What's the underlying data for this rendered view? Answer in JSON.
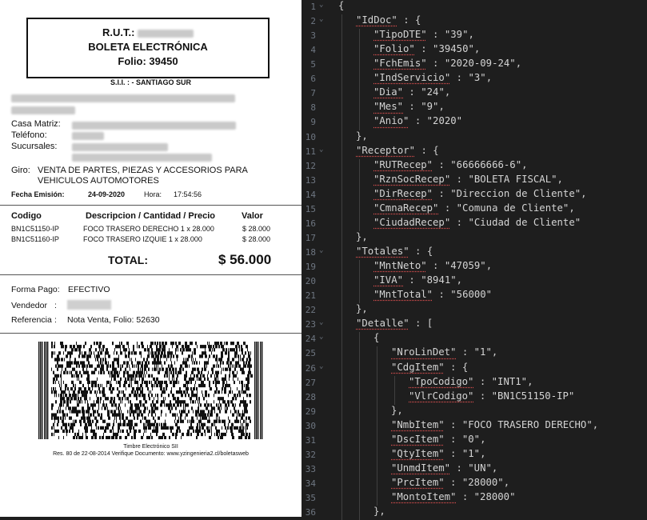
{
  "receipt": {
    "rut_label": "R.U.T.:",
    "doc_type": "BOLETA ELECTRÓNICA",
    "folio_line": "Folio: 39450",
    "sii_office": "S.I.I. : - SANTIAGO SUR",
    "casa_matriz_label": "Casa Matriz:",
    "telefono_label": "Teléfono:",
    "sucursales_label": "Sucursales:",
    "giro_label": "Giro:",
    "giro_line1": "VENTA DE PARTES, PIEZAS Y ACCESORIOS PARA",
    "giro_line2": "VEHICULOS AUTOMOTORES",
    "fecha_label": "Fecha Emisión:",
    "fecha_value": "24-09-2020",
    "hora_label": "Hora:",
    "hora_value": "17:54:56",
    "col_codigo": "Codigo",
    "col_desc": "Descripcion / Cantidad / Precio",
    "col_valor": "Valor",
    "items": [
      {
        "code": "BN1C51150-IP",
        "desc": "FOCO TRASERO DERECHO 1 x 28.000",
        "value": "$ 28.000"
      },
      {
        "code": "BN1C51160-IP",
        "desc": "FOCO TRASERO IZQUIE 1 x 28.000",
        "value": "$ 28.000"
      }
    ],
    "total_label": "TOTAL:",
    "total_value": "$ 56.000",
    "forma_pago_label": "Forma Pago:",
    "forma_pago_value": "EFECTIVO",
    "vendedor_label": "Vendedor",
    "vendedor_sep": ":",
    "referencia_label": "Referencia",
    "referencia_sep": ":",
    "referencia_value": "Nota Venta, Folio: 52630",
    "timbre_label": "Timbre Electrónico SII",
    "resolution_line": "Res. 80 de 22-08-2014 Verifique Documento: www.yzingenieria2.cl/boletasweb"
  },
  "editor": {
    "lines": [
      {
        "n": "1",
        "fold": "⌄",
        "indent": 0,
        "parts": [
          [
            "p",
            "{"
          ]
        ]
      },
      {
        "n": "2",
        "fold": "⌄",
        "indent": 1,
        "parts": [
          [
            "k",
            "\"IdDoc\""
          ],
          [
            "p",
            " : {"
          ]
        ]
      },
      {
        "n": "3",
        "fold": "",
        "indent": 2,
        "parts": [
          [
            "k",
            "\"TipoDTE\""
          ],
          [
            "p",
            " : "
          ],
          [
            "v",
            "\"39\""
          ],
          [
            "p",
            ","
          ]
        ]
      },
      {
        "n": "4",
        "fold": "",
        "indent": 2,
        "parts": [
          [
            "k",
            "\"Folio\""
          ],
          [
            "p",
            " : "
          ],
          [
            "v",
            "\"39450\""
          ],
          [
            "p",
            ","
          ]
        ]
      },
      {
        "n": "5",
        "fold": "",
        "indent": 2,
        "parts": [
          [
            "k",
            "\"FchEmis\""
          ],
          [
            "p",
            " : "
          ],
          [
            "v",
            "\"2020-09-24\""
          ],
          [
            "p",
            ","
          ]
        ]
      },
      {
        "n": "6",
        "fold": "",
        "indent": 2,
        "parts": [
          [
            "k",
            "\"IndServicio\""
          ],
          [
            "p",
            " : "
          ],
          [
            "v",
            "\"3\""
          ],
          [
            "p",
            ","
          ]
        ]
      },
      {
        "n": "7",
        "fold": "",
        "indent": 2,
        "parts": [
          [
            "k",
            "\"Dia\""
          ],
          [
            "p",
            " : "
          ],
          [
            "v",
            "\"24\""
          ],
          [
            "p",
            ","
          ]
        ]
      },
      {
        "n": "8",
        "fold": "",
        "indent": 2,
        "parts": [
          [
            "k",
            "\"Mes\""
          ],
          [
            "p",
            " : "
          ],
          [
            "v",
            "\"9\""
          ],
          [
            "p",
            ","
          ]
        ]
      },
      {
        "n": "9",
        "fold": "",
        "indent": 2,
        "parts": [
          [
            "k",
            "\"Anio\""
          ],
          [
            "p",
            " : "
          ],
          [
            "v",
            "\"2020\""
          ]
        ]
      },
      {
        "n": "10",
        "fold": "",
        "indent": 1,
        "parts": [
          [
            "p",
            "},"
          ]
        ]
      },
      {
        "n": "11",
        "fold": "⌄",
        "indent": 1,
        "parts": [
          [
            "k",
            "\"Receptor\""
          ],
          [
            "p",
            " : {"
          ]
        ]
      },
      {
        "n": "12",
        "fold": "",
        "indent": 2,
        "parts": [
          [
            "k",
            "\"RUTRecep\""
          ],
          [
            "p",
            " : "
          ],
          [
            "v",
            "\"66666666-6\""
          ],
          [
            "p",
            ","
          ]
        ]
      },
      {
        "n": "13",
        "fold": "",
        "indent": 2,
        "parts": [
          [
            "k",
            "\"RznSocRecep\""
          ],
          [
            "p",
            " : "
          ],
          [
            "v",
            "\"BOLETA FISCAL\""
          ],
          [
            "p",
            ","
          ]
        ]
      },
      {
        "n": "14",
        "fold": "",
        "indent": 2,
        "parts": [
          [
            "k",
            "\"DirRecep\""
          ],
          [
            "p",
            " : "
          ],
          [
            "v",
            "\"Direccion de Cliente\""
          ],
          [
            "p",
            ","
          ]
        ]
      },
      {
        "n": "15",
        "fold": "",
        "indent": 2,
        "parts": [
          [
            "k",
            "\"CmnaRecep\""
          ],
          [
            "p",
            " : "
          ],
          [
            "v",
            "\"Comuna de Cliente\""
          ],
          [
            "p",
            ","
          ]
        ]
      },
      {
        "n": "16",
        "fold": "",
        "indent": 2,
        "parts": [
          [
            "k",
            "\"CiudadRecep\""
          ],
          [
            "p",
            " : "
          ],
          [
            "v",
            "\"Ciudad de Cliente\""
          ]
        ]
      },
      {
        "n": "17",
        "fold": "",
        "indent": 1,
        "parts": [
          [
            "p",
            "},"
          ]
        ]
      },
      {
        "n": "18",
        "fold": "⌄",
        "indent": 1,
        "parts": [
          [
            "k",
            "\"Totales\""
          ],
          [
            "p",
            " : {"
          ]
        ]
      },
      {
        "n": "19",
        "fold": "",
        "indent": 2,
        "parts": [
          [
            "k",
            "\"MntNeto\""
          ],
          [
            "p",
            " : "
          ],
          [
            "v",
            "\"47059\""
          ],
          [
            "p",
            ","
          ]
        ]
      },
      {
        "n": "20",
        "fold": "",
        "indent": 2,
        "parts": [
          [
            "k",
            "\"IVA\""
          ],
          [
            "p",
            " : "
          ],
          [
            "v",
            "\"8941\""
          ],
          [
            "p",
            ","
          ]
        ]
      },
      {
        "n": "21",
        "fold": "",
        "indent": 2,
        "parts": [
          [
            "k",
            "\"MntTotal\""
          ],
          [
            "p",
            " : "
          ],
          [
            "v",
            "\"56000\""
          ]
        ]
      },
      {
        "n": "22",
        "fold": "",
        "indent": 1,
        "parts": [
          [
            "p",
            "},"
          ]
        ]
      },
      {
        "n": "23",
        "fold": "⌄",
        "indent": 1,
        "parts": [
          [
            "k",
            "\"Detalle\""
          ],
          [
            "p",
            " : ["
          ]
        ]
      },
      {
        "n": "24",
        "fold": "⌄",
        "indent": 2,
        "parts": [
          [
            "p",
            "{"
          ]
        ]
      },
      {
        "n": "25",
        "fold": "",
        "indent": 3,
        "parts": [
          [
            "k",
            "\"NroLinDet\""
          ],
          [
            "p",
            " : "
          ],
          [
            "v",
            "\"1\""
          ],
          [
            "p",
            ","
          ]
        ]
      },
      {
        "n": "26",
        "fold": "⌄",
        "indent": 3,
        "parts": [
          [
            "k",
            "\"CdgItem\""
          ],
          [
            "p",
            " : {"
          ]
        ]
      },
      {
        "n": "27",
        "fold": "",
        "indent": 4,
        "parts": [
          [
            "k",
            "\"TpoCodigo\""
          ],
          [
            "p",
            " : "
          ],
          [
            "v",
            "\"INT1\""
          ],
          [
            "p",
            ","
          ]
        ]
      },
      {
        "n": "28",
        "fold": "",
        "indent": 4,
        "parts": [
          [
            "k",
            "\"VlrCodigo\""
          ],
          [
            "p",
            " : "
          ],
          [
            "v",
            "\"BN1C51150-IP\""
          ]
        ]
      },
      {
        "n": "29",
        "fold": "",
        "indent": 3,
        "parts": [
          [
            "p",
            "},"
          ]
        ]
      },
      {
        "n": "30",
        "fold": "",
        "indent": 3,
        "parts": [
          [
            "k",
            "\"NmbItem\""
          ],
          [
            "p",
            " : "
          ],
          [
            "v",
            "\"FOCO TRASERO DERECHO\""
          ],
          [
            "p",
            ","
          ]
        ]
      },
      {
        "n": "31",
        "fold": "",
        "indent": 3,
        "parts": [
          [
            "k",
            "\"DscItem\""
          ],
          [
            "p",
            " : "
          ],
          [
            "v",
            "\"0\""
          ],
          [
            "p",
            ","
          ]
        ]
      },
      {
        "n": "32",
        "fold": "",
        "indent": 3,
        "parts": [
          [
            "k",
            "\"QtyItem\""
          ],
          [
            "p",
            " : "
          ],
          [
            "v",
            "\"1\""
          ],
          [
            "p",
            ","
          ]
        ]
      },
      {
        "n": "33",
        "fold": "",
        "indent": 3,
        "parts": [
          [
            "k",
            "\"UnmdItem\""
          ],
          [
            "p",
            " : "
          ],
          [
            "v",
            "\"UN\""
          ],
          [
            "p",
            ","
          ]
        ]
      },
      {
        "n": "34",
        "fold": "",
        "indent": 3,
        "parts": [
          [
            "k",
            "\"PrcItem\""
          ],
          [
            "p",
            " : "
          ],
          [
            "v",
            "\"28000\""
          ],
          [
            "p",
            ","
          ]
        ]
      },
      {
        "n": "35",
        "fold": "",
        "indent": 3,
        "parts": [
          [
            "k",
            "\"MontoItem\""
          ],
          [
            "p",
            " : "
          ],
          [
            "v",
            "\"28000\""
          ]
        ]
      },
      {
        "n": "36",
        "fold": "",
        "indent": 2,
        "parts": [
          [
            "p",
            "},"
          ]
        ]
      }
    ]
  }
}
